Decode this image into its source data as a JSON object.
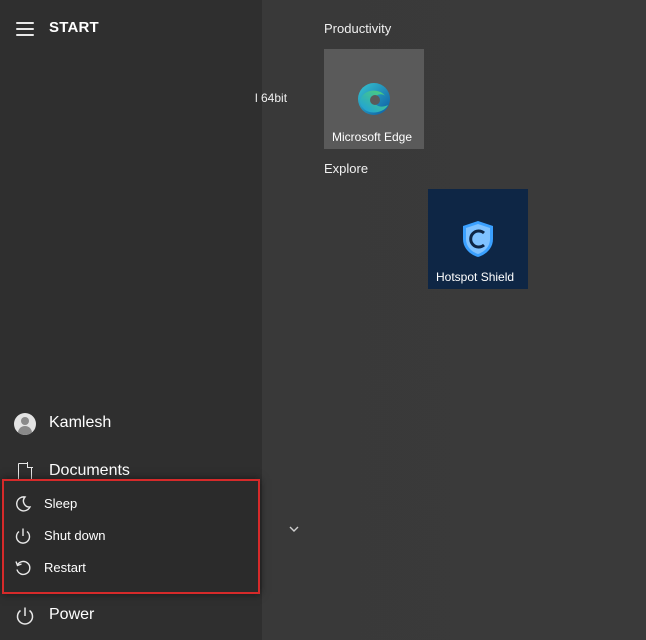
{
  "header": {
    "title": "START"
  },
  "user": {
    "name": "Kamlesh"
  },
  "documents": {
    "label": "Documents"
  },
  "power_menu": {
    "sleep": "Sleep",
    "shutdown": "Shut down",
    "restart": "Restart"
  },
  "power": {
    "label": "Power"
  },
  "truncated_app_text": "l 64bit",
  "groups": {
    "productivity": {
      "label": "Productivity",
      "tiles": [
        {
          "label": "Microsoft Edge",
          "icon": "edge-icon"
        }
      ]
    },
    "explore": {
      "label": "Explore",
      "tiles": [
        {
          "label": "Hotspot Shield",
          "icon": "shield-icon"
        }
      ]
    }
  },
  "colors": {
    "highlight_border": "#d62a2a",
    "hotspot_tile_bg": "#0e2645",
    "edge_tile_bg": "#5a5a5a"
  }
}
